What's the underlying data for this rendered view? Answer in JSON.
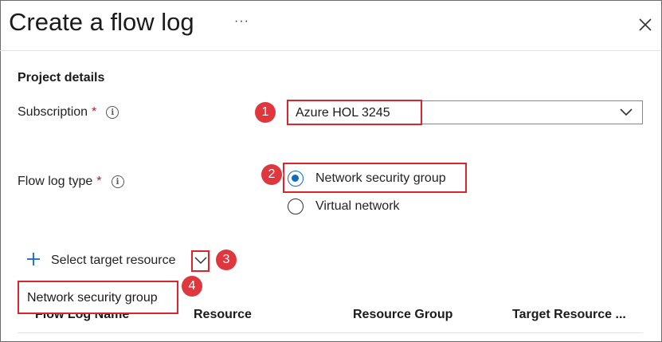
{
  "header": {
    "title": "Create a flow log",
    "more_label": "···",
    "close_icon": "close-icon"
  },
  "project": {
    "section_title": "Project details",
    "subscription": {
      "label": "Subscription",
      "required_mark": "*",
      "info_glyph": "i",
      "value": "Azure HOL 3245"
    },
    "flow_log_type": {
      "label": "Flow log type",
      "required_mark": "*",
      "info_glyph": "i",
      "options": [
        {
          "label": "Network security group",
          "checked": true
        },
        {
          "label": "Virtual network",
          "checked": false
        }
      ]
    }
  },
  "target": {
    "label": "Select target resource",
    "dropdown_option": "Network security group"
  },
  "table": {
    "columns": [
      "Flow Log Name",
      "Resource",
      "Resource Group",
      "Target Resource ..."
    ]
  },
  "annotations": {
    "markers": [
      "1",
      "2",
      "3",
      "4"
    ],
    "highlight_color": "#d9262c"
  },
  "colors": {
    "accent": "#0f6cbd",
    "required": "#a4262c",
    "marker": "#e0373f"
  }
}
